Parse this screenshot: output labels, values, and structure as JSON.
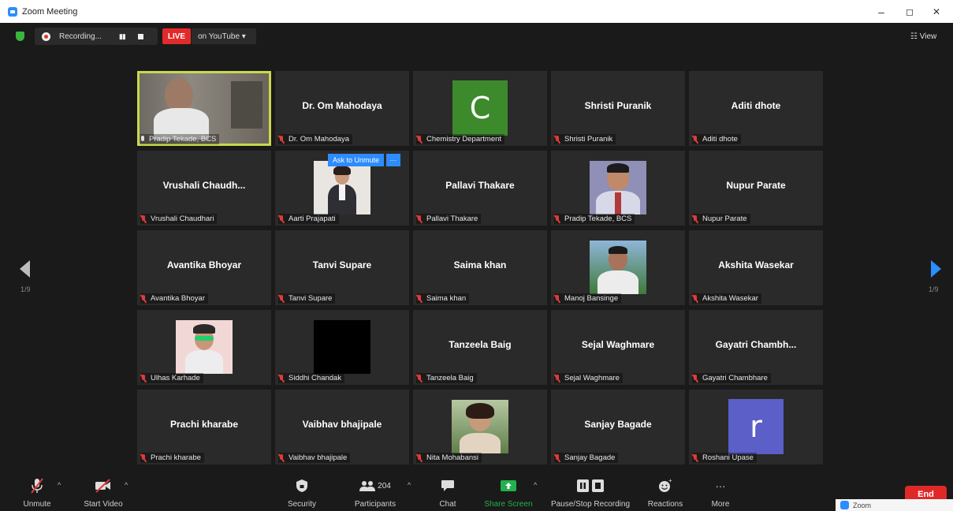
{
  "window": {
    "title": "Zoom Meeting",
    "min_glyph": "–",
    "max_glyph": "◻",
    "close_glyph": "✕"
  },
  "topbar": {
    "recording_label": "Recording...",
    "pause_glyph": "▮▮",
    "live_label": "LIVE",
    "stream_label": "on YouTube ▾",
    "view_label": "☷ View"
  },
  "pagination": {
    "left": "1/9",
    "right": "1/9"
  },
  "unmute_popup": {
    "ask_label": "Ask to Unmute",
    "more_label": "···"
  },
  "tiles": [
    {
      "label": "Pradip Tekade, BCS",
      "kind": "video",
      "speaker": true,
      "mic": "on"
    },
    {
      "label": "Dr. Om Mahodaya",
      "display": "Dr. Om Mahodaya",
      "kind": "name"
    },
    {
      "label": "Chemistry Department",
      "kind": "letter",
      "letter": "C",
      "color": "#3d8a2c"
    },
    {
      "label": "Shristi Puranik",
      "display": "Shristi Puranik",
      "kind": "name"
    },
    {
      "label": "Aditi dhote",
      "display": "Aditi dhote",
      "kind": "name"
    },
    {
      "label": "Vrushali Chaudhari",
      "display": "Vrushali  Chaudh...",
      "kind": "name"
    },
    {
      "label": "Aarti Prajapati",
      "kind": "photo",
      "photo": "woman-light"
    },
    {
      "label": "Pallavi Thakare",
      "display": "Pallavi Thakare",
      "kind": "name"
    },
    {
      "label": "Pradip Tekade, BCS",
      "kind": "photo",
      "photo": "man-portrait"
    },
    {
      "label": "Nupur Parate",
      "display": "Nupur Parate",
      "kind": "name"
    },
    {
      "label": "Avantika Bhoyar",
      "display": "Avantika Bhoyar",
      "kind": "name"
    },
    {
      "label": "Tanvi Supare",
      "display": "Tanvi Supare",
      "kind": "name"
    },
    {
      "label": "Saima khan",
      "display": "Saima khan",
      "kind": "name"
    },
    {
      "label": "Manoj Bansinge",
      "kind": "photo",
      "photo": "man-outdoor"
    },
    {
      "label": "Akshita Wasekar",
      "display": "Akshita Wasekar",
      "kind": "name"
    },
    {
      "label": "Ulhas Karhade",
      "kind": "photo",
      "photo": "man-sunglasses"
    },
    {
      "label": "Siddhi Chandak",
      "kind": "photo",
      "photo": "black"
    },
    {
      "label": "Tanzeela Baig",
      "display": "Tanzeela Baig",
      "kind": "name"
    },
    {
      "label": "Sejal Waghmare",
      "display": "Sejal Waghmare",
      "kind": "name"
    },
    {
      "label": "Gayatri Chambhare",
      "display": "Gayatri  Chambh...",
      "kind": "name"
    },
    {
      "label": "Prachi kharabe",
      "display": "Prachi kharabe",
      "kind": "name"
    },
    {
      "label": "Vaibhav  bhajipale",
      "display": "Vaibhav  bhajipale",
      "kind": "name"
    },
    {
      "label": "Nita Mohabansi",
      "kind": "photo",
      "photo": "woman-outdoor"
    },
    {
      "label": "Sanjay Bagade",
      "display": "Sanjay Bagade",
      "kind": "name"
    },
    {
      "label": "Roshani Upase",
      "kind": "letter",
      "letter": "r",
      "color": "#5b5fc7"
    }
  ],
  "toolbar": {
    "unmute": "Unmute",
    "start_video": "Start Video",
    "security": "Security",
    "participants": "Participants",
    "participants_count": "204",
    "chat": "Chat",
    "share_screen": "Share Screen",
    "pause_stop": "Pause/Stop Recording",
    "reactions": "Reactions",
    "more": "More",
    "end": "End",
    "caret": "^",
    "more_glyph": "···"
  },
  "toast": {
    "text": "Zoom"
  },
  "colors": {
    "accent": "#2d8cff",
    "share_green": "#23b14d",
    "end_red": "#e02828",
    "live_red": "#e22a2a",
    "speaker_border": "#c9d94a"
  }
}
